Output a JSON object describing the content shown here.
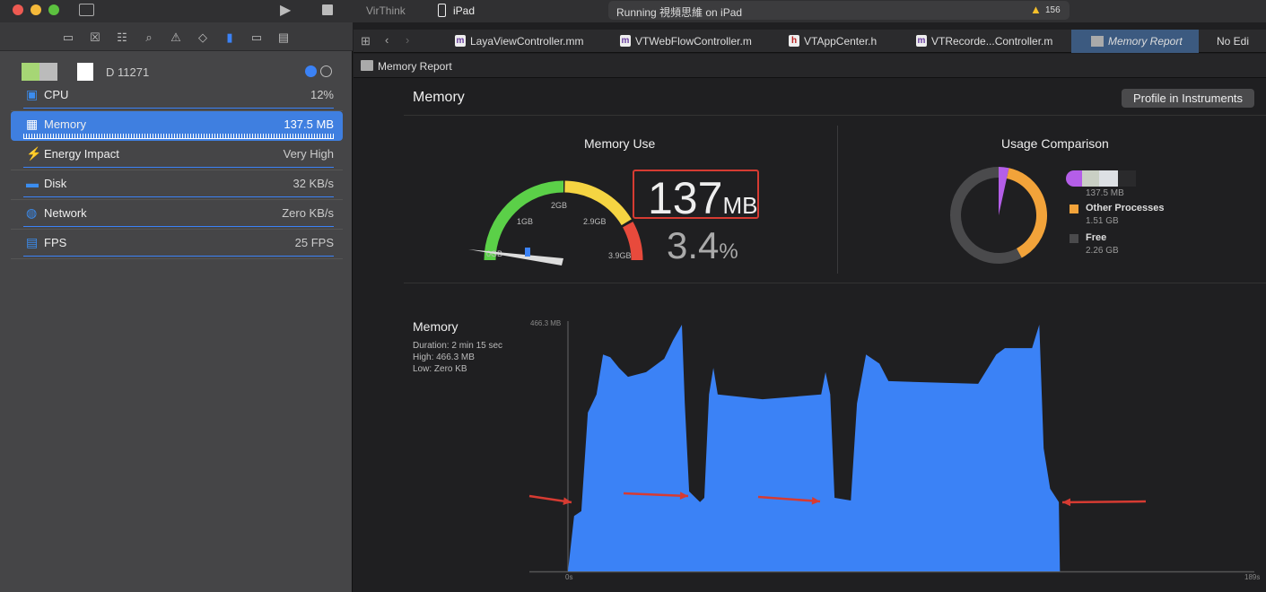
{
  "titlebar": {
    "scheme": "VirThink",
    "device": "iPad",
    "status": "Running 視頻思維 on iPad",
    "warnings": "156"
  },
  "sidebar": {
    "process": "D 11271",
    "gauges": [
      {
        "label": "CPU",
        "value": "12%",
        "icon": "cpu-icon"
      },
      {
        "label": "Memory",
        "value": "137.5 MB",
        "icon": "memory-icon",
        "selected": true
      },
      {
        "label": "Energy Impact",
        "value": "Very High",
        "icon": "bolt-icon"
      },
      {
        "label": "Disk",
        "value": "32 KB/s",
        "icon": "disk-icon"
      },
      {
        "label": "Network",
        "value": "Zero KB/s",
        "icon": "globe-icon"
      },
      {
        "label": "FPS",
        "value": "25 FPS",
        "icon": "fps-icon"
      }
    ]
  },
  "tabs": [
    {
      "label": "LayaViewController.mm",
      "type": "m"
    },
    {
      "label": "VTWebFlowController.m",
      "type": "m"
    },
    {
      "label": "VTAppCenter.h",
      "type": "h"
    },
    {
      "label": "VTRecorde...Controller.m",
      "type": "m"
    },
    {
      "label": "Memory Report",
      "active": true
    },
    {
      "label": "No Edi"
    }
  ],
  "breadcrumb": "Memory Report",
  "report": {
    "title": "Memory",
    "profile_button": "Profile in Instruments",
    "memory_use": {
      "title": "Memory Use",
      "value": "137",
      "unit": "MB",
      "percent": "3.4",
      "percent_unit": "%",
      "ticks": [
        "0GB",
        "1GB",
        "2GB",
        "2.9GB",
        "3.9GB"
      ],
      "needle_gb": 0.13
    },
    "usage": {
      "title": "Usage Comparison",
      "legend": [
        {
          "name": "",
          "value": "137.5 MB",
          "color": "#b45ee8",
          "gb": 0.134
        },
        {
          "name": "Other Processes",
          "value": "1.51 GB",
          "color": "#f2a33a",
          "gb": 1.51
        },
        {
          "name": "Free",
          "value": "2.26 GB",
          "color": "#4a4a4c",
          "gb": 2.26
        }
      ]
    },
    "graph": {
      "title": "Memory",
      "duration": "Duration: 2 min 15 sec",
      "high": "High: 466.3 MB",
      "low": "Low: Zero KB"
    }
  },
  "chart_data": {
    "type": "area",
    "ylabel": "",
    "xlabel": "",
    "y_tick": "466.3 MB",
    "x_ticks": [
      "0s",
      "189s"
    ],
    "xlim": [
      0,
      189
    ],
    "ylim": [
      0,
      466.3
    ],
    "color": "#3b82f6",
    "x": [
      0,
      1.7,
      3.7,
      5.5,
      7.9,
      9.7,
      11.7,
      14.1,
      16.6,
      21.6,
      26.6,
      29,
      31.5,
      32.3,
      33.5,
      36.5,
      37.7,
      39,
      40.2,
      41.4,
      53.8,
      70,
      71.2,
      72.5,
      73.7,
      78.2,
      79.9,
      82.4,
      86.1,
      88.6,
      113.4,
      118.4,
      120.8,
      128.3,
      130.3,
      131.5,
      133.3,
      135.7,
      136
    ],
    "values": [
      0,
      104,
      113,
      298,
      332,
      407,
      402,
      382,
      365,
      374,
      399,
      433,
      463,
      315,
      150,
      130,
      138,
      332,
      382,
      332,
      323,
      332,
      374,
      332,
      138,
      133,
      315,
      407,
      390,
      357,
      352,
      407,
      419,
      419,
      463,
      231,
      155,
      130,
      0
    ]
  }
}
